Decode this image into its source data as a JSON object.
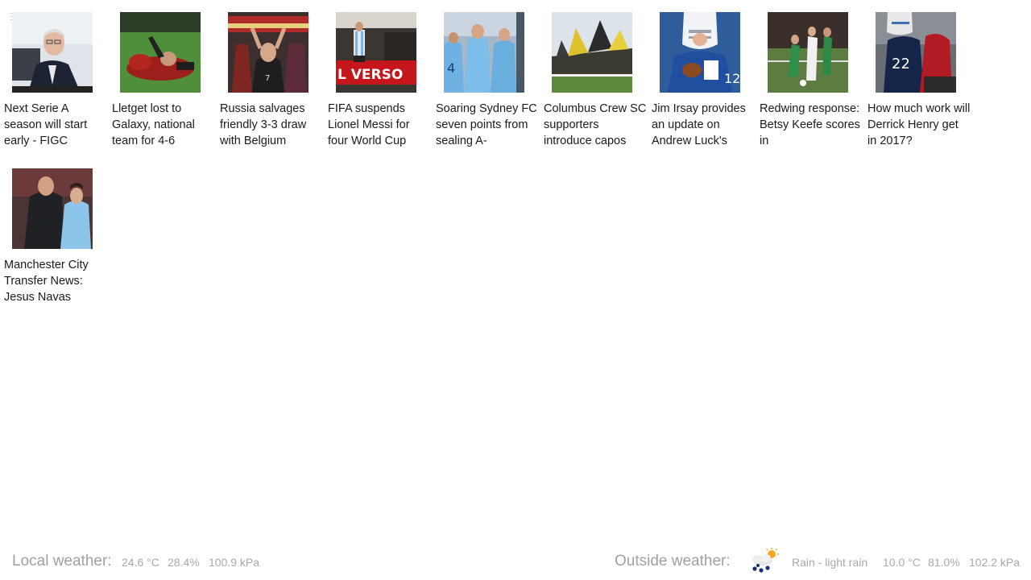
{
  "menu": {
    "icon": "hamburger-icon"
  },
  "articles": [
    {
      "title": "Next Serie A season will start early - FIGC",
      "image": "man-in-suit-photo"
    },
    {
      "title": "Lletget lost to Galaxy, national team for 4-6",
      "image": "injured-player-photo"
    },
    {
      "title": "Russia salvages friendly 3-3 draw with Belgium",
      "image": "fans-cheering-photo"
    },
    {
      "title": "FIFA suspends Lionel Messi for four World Cup",
      "image": "messi-photo"
    },
    {
      "title": "Soaring Sydney FC seven points from sealing A-",
      "image": "sydney-fc-players-photo"
    },
    {
      "title": "Columbus Crew SC supporters introduce capos",
      "image": "stadium-flags-photo"
    },
    {
      "title": "Jim Irsay provides an update on Andrew Luck's",
      "image": "quarterback-photo"
    },
    {
      "title": "Redwing response: Betsy Keefe scores in",
      "image": "womens-soccer-photo"
    },
    {
      "title": "How much work will Derrick Henry get in 2017?",
      "image": "running-back-photo"
    },
    {
      "title": "Manchester City Transfer News: Jesus Navas",
      "image": "man-city-coach-photo"
    }
  ],
  "weather": {
    "local_label": "Local weather:",
    "local_temp": "24.6 °C",
    "local_humidity": "28.4%",
    "local_pressure": "100.9 kPa",
    "outside_label": "Outside weather:",
    "outside_icon": "rain-sun-icon",
    "outside_condition": "Rain - light rain",
    "outside_temp": "10.0 °C",
    "outside_humidity": "81.0%",
    "outside_pressure": "102.2 kPa"
  }
}
